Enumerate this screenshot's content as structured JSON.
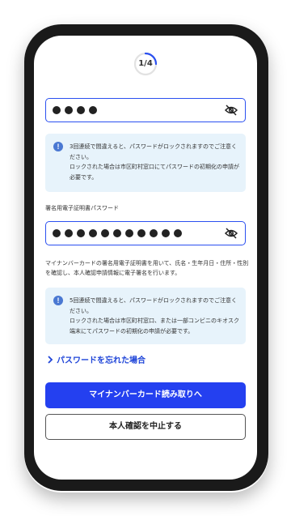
{
  "progress": {
    "label": "1/4",
    "fraction": 0.25,
    "accent_color": "#2b50f0"
  },
  "first_password": {
    "dot_count": 4,
    "toggle_icon": "eye-slash-icon"
  },
  "first_notice": {
    "icon": "info-icon",
    "line1": "3回連続で間違えると、パスワードがロックされますのでご注意ください。",
    "line2": "ロックされた場合は市区町村窓口にてパスワードの初期化の申請が必要です。"
  },
  "signature_password": {
    "label": "署名用電子証明書パスワード",
    "dot_count": 11,
    "toggle_icon": "eye-slash-icon",
    "description": "マイナンバーカードの署名用電子証明書を用いて、氏名・生年月日・住所・性別を確認し、本人確認申請情報に電子署名を行います。"
  },
  "second_notice": {
    "icon": "info-icon",
    "line1": "5回連続で間違えると、パスワードがロックされますのでご注意ください。",
    "line2": "ロックされた場合は市区町村窓口、または一部コンビニのキオスク端末にてパスワードの初期化の申請が必要です。"
  },
  "forgot_link": {
    "label": "パスワードを忘れた場合",
    "icon": "chevron-right-icon"
  },
  "buttons": {
    "primary": "マイナンバーカード読み取りへ",
    "secondary": "本人確認を中止する"
  },
  "colors": {
    "primary": "#2440f0",
    "link": "#1e44d8",
    "notice_bg": "#e7f3fb",
    "notice_icon": "#4a78d2"
  }
}
